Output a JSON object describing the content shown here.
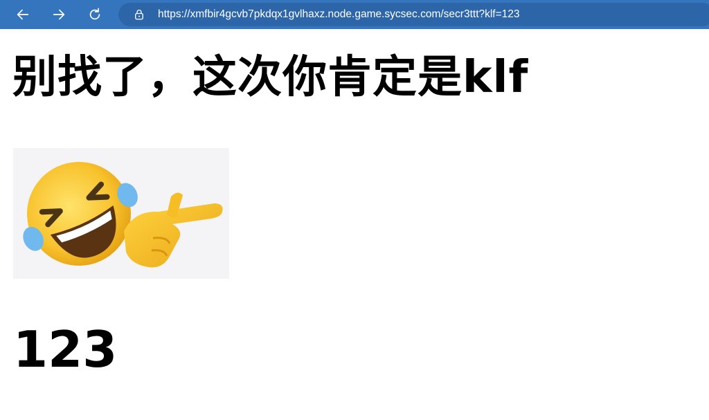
{
  "browser": {
    "url": "https://xmfbir4gcvb7pkdqx1gvlhaxz.node.game.sycsec.com/secr3ttt?klf=123",
    "toolbar_color": "#3575bd",
    "address_bar_color": "#2c65a8",
    "icons": [
      "back-arrow-icon",
      "forward-arrow-icon",
      "refresh-icon",
      "lock-icon"
    ]
  },
  "page": {
    "heading": "别找了，这次你肯定是klf",
    "image": {
      "icon": "laughing-crying-emoji-pointing-icon"
    },
    "value": "123"
  }
}
